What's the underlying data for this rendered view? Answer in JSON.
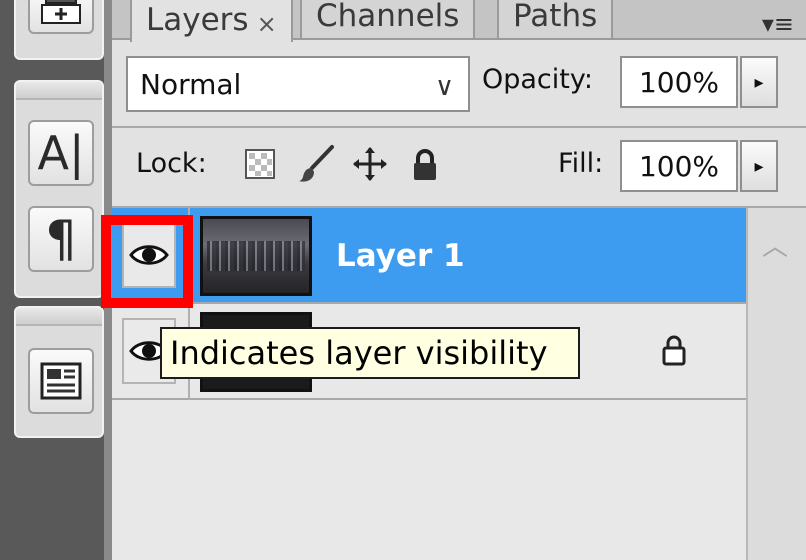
{
  "tabs": {
    "layers": {
      "label": "Layers",
      "close": "×"
    },
    "channels": {
      "label": "Channels"
    },
    "paths": {
      "label": "Paths"
    }
  },
  "panel_menu_glyph": "▾≡",
  "tools": {
    "type_glyph": "A|",
    "paragraph_glyph": "¶"
  },
  "blend": {
    "value": "Normal",
    "chevron": "∨"
  },
  "opacity": {
    "label": "Opacity:",
    "value": "100%"
  },
  "lock": {
    "label": "Lock:"
  },
  "fill": {
    "label": "Fill:",
    "value": "100%"
  },
  "stepper_glyph": "▸",
  "layers": [
    {
      "name": "Layer 1",
      "selected": true
    },
    {
      "name": "",
      "selected": false
    }
  ],
  "tooltip": {
    "text": "Indicates layer visibility"
  },
  "colors": {
    "selected_row": "#3d9bf0",
    "highlight": "#ff0000",
    "tooltip_bg": "#ffffe1"
  }
}
